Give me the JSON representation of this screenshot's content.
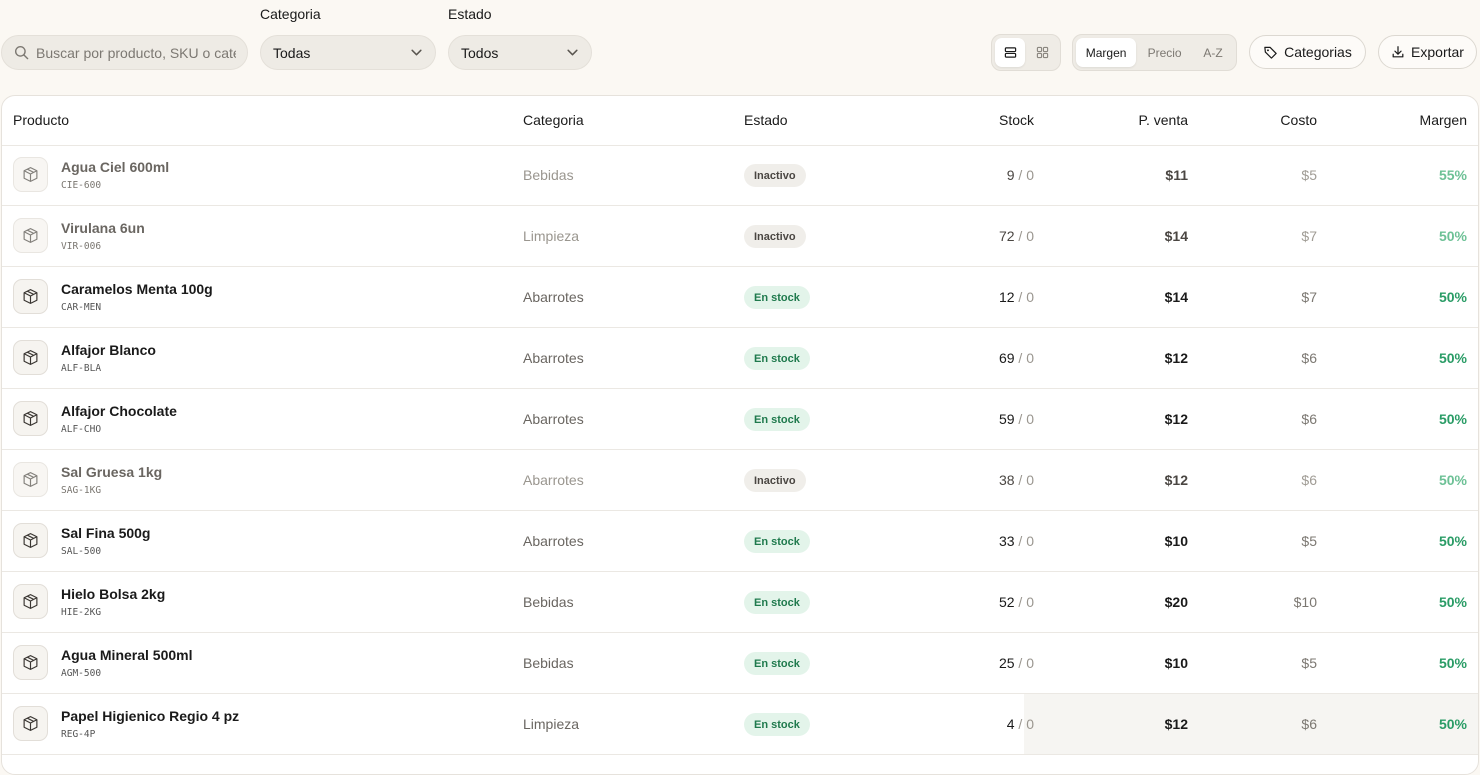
{
  "search": {
    "placeholder": "Buscar por producto, SKU o categoría"
  },
  "filters": {
    "category": {
      "label": "Categoria",
      "value": "Todas"
    },
    "status": {
      "label": "Estado",
      "value": "Todos"
    }
  },
  "view_toggle": {
    "active": "list"
  },
  "sort": {
    "items": [
      "Margen",
      "Precio",
      "A-Z"
    ],
    "active": "Margen"
  },
  "buttons": {
    "categories": "Categorias",
    "export": "Exportar"
  },
  "table": {
    "headers": {
      "product": "Producto",
      "category": "Categoria",
      "status": "Estado",
      "stock": "Stock",
      "price": "P. venta",
      "cost": "Costo",
      "margin": "Margen"
    },
    "rows": [
      {
        "name": "Agua Ciel 600ml",
        "sku": "CIE-600",
        "category": "Bebidas",
        "status": "Inactivo",
        "stock": "9",
        "stock_min": "/ 0",
        "price": "$11",
        "cost": "$5",
        "margin": "55%"
      },
      {
        "name": "Virulana 6un",
        "sku": "VIR-006",
        "category": "Limpieza",
        "status": "Inactivo",
        "stock": "72",
        "stock_min": "/ 0",
        "price": "$14",
        "cost": "$7",
        "margin": "50%"
      },
      {
        "name": "Caramelos Menta 100g",
        "sku": "CAR-MEN",
        "category": "Abarrotes",
        "status": "En stock",
        "stock": "12",
        "stock_min": "/ 0",
        "price": "$14",
        "cost": "$7",
        "margin": "50%"
      },
      {
        "name": "Alfajor Blanco",
        "sku": "ALF-BLA",
        "category": "Abarrotes",
        "status": "En stock",
        "stock": "69",
        "stock_min": "/ 0",
        "price": "$12",
        "cost": "$6",
        "margin": "50%"
      },
      {
        "name": "Alfajor Chocolate",
        "sku": "ALF-CHO",
        "category": "Abarrotes",
        "status": "En stock",
        "stock": "59",
        "stock_min": "/ 0",
        "price": "$12",
        "cost": "$6",
        "margin": "50%"
      },
      {
        "name": "Sal Gruesa 1kg",
        "sku": "SAG-1KG",
        "category": "Abarrotes",
        "status": "Inactivo",
        "stock": "38",
        "stock_min": "/ 0",
        "price": "$12",
        "cost": "$6",
        "margin": "50%"
      },
      {
        "name": "Sal Fina 500g",
        "sku": "SAL-500",
        "category": "Abarrotes",
        "status": "En stock",
        "stock": "33",
        "stock_min": "/ 0",
        "price": "$10",
        "cost": "$5",
        "margin": "50%"
      },
      {
        "name": "Hielo Bolsa 2kg",
        "sku": "HIE-2KG",
        "category": "Bebidas",
        "status": "En stock",
        "stock": "52",
        "stock_min": "/ 0",
        "price": "$20",
        "cost": "$10",
        "margin": "50%"
      },
      {
        "name": "Agua Mineral 500ml",
        "sku": "AGM-500",
        "category": "Bebidas",
        "status": "En stock",
        "stock": "25",
        "stock_min": "/ 0",
        "price": "$10",
        "cost": "$5",
        "margin": "50%"
      },
      {
        "name": "Papel Higienico Regio 4 pz",
        "sku": "REG-4P",
        "category": "Limpieza",
        "status": "En stock",
        "stock": "4",
        "stock_min": "/ 0",
        "price": "$12",
        "cost": "$6",
        "margin": "50%"
      }
    ]
  },
  "colors": {
    "background": "#fbf8f3",
    "instock_bg": "#e3f4ea",
    "instock_text": "#1f7a4d",
    "margin_green": "#2a9c66"
  }
}
